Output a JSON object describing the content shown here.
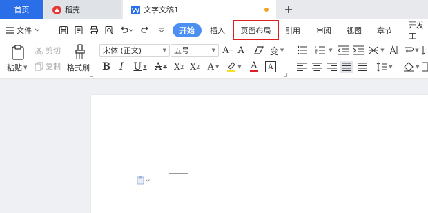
{
  "tabs": {
    "home": "首页",
    "daoke": "稻壳",
    "doc": "文字文稿1"
  },
  "menu": {
    "file": "文件",
    "ribbon_tabs": [
      "开始",
      "插入",
      "页面布局",
      "引用",
      "审阅",
      "视图",
      "章节",
      "开发工"
    ]
  },
  "ribbon": {
    "paste": "粘贴",
    "cut": "剪切",
    "copy": "复制",
    "format_painter": "格式刷",
    "font_name": "宋体 (正文)",
    "font_size": "五号"
  },
  "colors": {
    "accent": "#2a6ee8",
    "start_pill": "#4c8ff2",
    "highlight_box": "#e02020",
    "modified_dot": "#f2a21c"
  }
}
